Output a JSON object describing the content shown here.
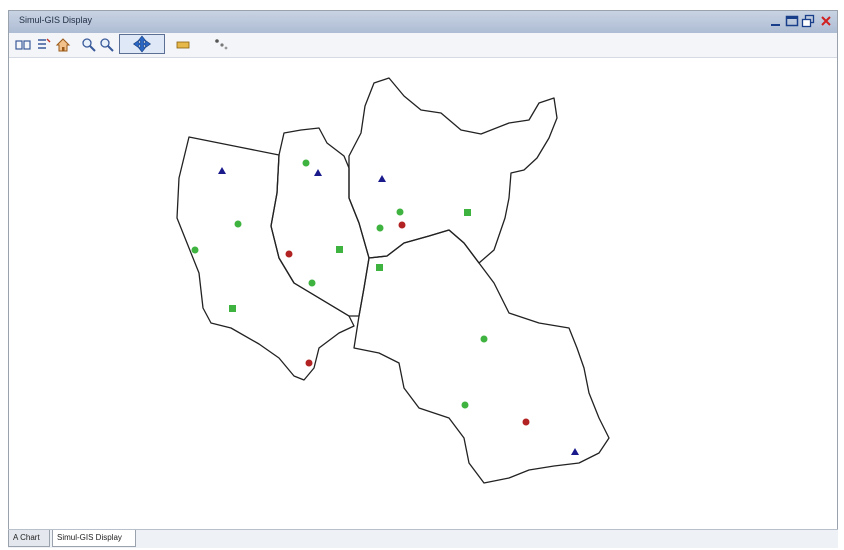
{
  "window": {
    "title": "Simul-GIS Display"
  },
  "toolbar": {
    "buttons": [
      "zoom-extent",
      "layers",
      "home",
      "zoom-in",
      "zoom-out",
      "pan",
      "measure",
      "select"
    ]
  },
  "map": {
    "regions": 4,
    "point_colors": {
      "green": "#3fb33f",
      "red": "#b22222",
      "blue": "#1a1a8c"
    }
  },
  "tabs": [
    {
      "label": "A Chart"
    },
    {
      "label": "Simul-GIS Display"
    }
  ]
}
